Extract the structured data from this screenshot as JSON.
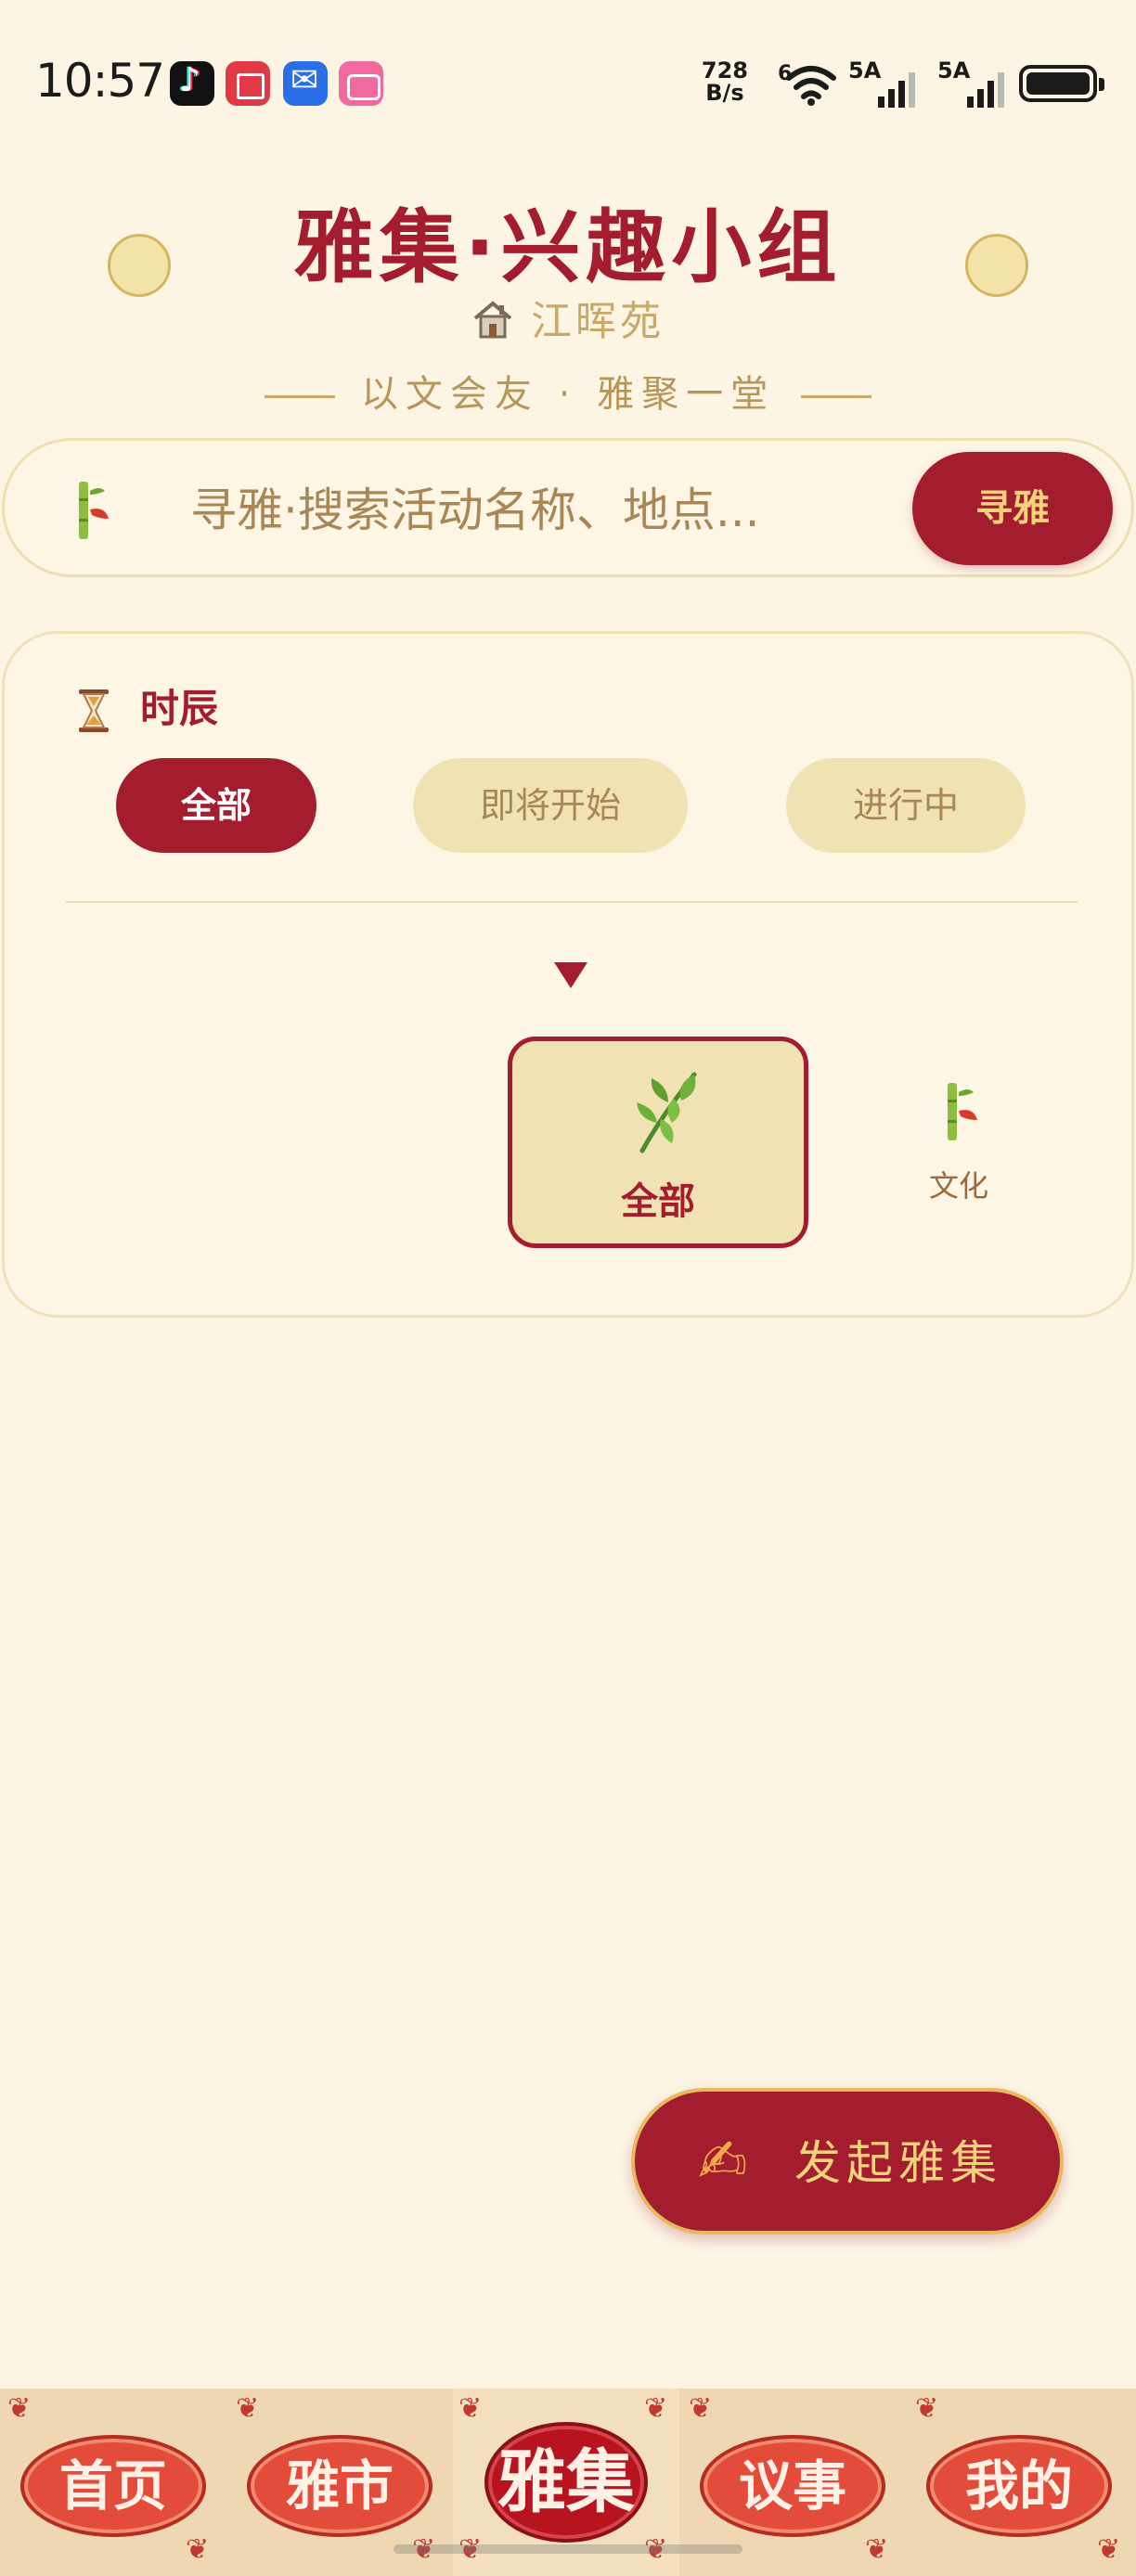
{
  "status_bar": {
    "time": "10:57",
    "net_speed_value": "728",
    "net_speed_unit": "B/s",
    "wifi_label": "6",
    "signal_1_label": "5A",
    "signal_2_label": "5A",
    "apps": [
      "tiktok-icon",
      "book-icon",
      "mail-icon",
      "bilibili-icon"
    ]
  },
  "header": {
    "title": "雅集·兴趣小组",
    "community": "江晖苑",
    "tagline": "以文会友 · 雅聚一堂"
  },
  "search": {
    "placeholder": "寻雅·搜索活动名称、地点...",
    "button_label": "寻雅"
  },
  "filter": {
    "title": "时辰",
    "time_options": [
      {
        "label": "全部",
        "selected": true
      },
      {
        "label": "即将开始",
        "selected": false
      },
      {
        "label": "进行中",
        "selected": false
      }
    ],
    "categories": [
      {
        "label": "全部",
        "icon": "sprig-icon",
        "selected": true
      },
      {
        "label": "文化",
        "icon": "bamboo-icon",
        "selected": false
      }
    ]
  },
  "fab": {
    "icon": "writing-hand-icon",
    "label": "发起雅集"
  },
  "bottom_nav": {
    "items": [
      {
        "label": "首页",
        "active": false
      },
      {
        "label": "雅市",
        "active": false
      },
      {
        "label": "雅集",
        "active": true
      },
      {
        "label": "议事",
        "active": false
      },
      {
        "label": "我的",
        "active": false
      }
    ]
  },
  "colors": {
    "background": "#fcf5e4",
    "primary": "#a31d2f",
    "gold": "#f2d37a",
    "pill_inactive": "#f1e2b3"
  }
}
